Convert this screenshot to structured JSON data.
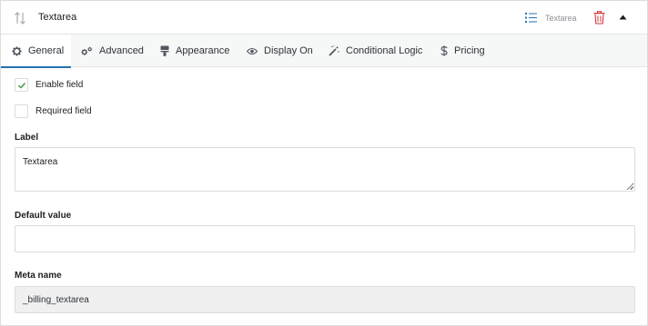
{
  "header": {
    "title": "Textarea",
    "type_label": "Textarea",
    "icons": {
      "sort": "sort-arrows-icon",
      "type": "list-icon",
      "delete": "trash-icon",
      "collapse": "caret-up-icon"
    }
  },
  "tabs": [
    {
      "label": "General",
      "icon": "gear-icon",
      "active": true
    },
    {
      "label": "Advanced",
      "icon": "gears-icon",
      "active": false
    },
    {
      "label": "Appearance",
      "icon": "paint-roller-icon",
      "active": false
    },
    {
      "label": "Display On",
      "icon": "eye-icon",
      "active": false
    },
    {
      "label": "Conditional Logic",
      "icon": "magic-wand-icon",
      "active": false
    },
    {
      "label": "Pricing",
      "icon": "dollar-icon",
      "active": false
    }
  ],
  "general": {
    "enable_field": {
      "label": "Enable field",
      "checked": true
    },
    "required_field": {
      "label": "Required field",
      "checked": false
    },
    "label": {
      "label": "Label",
      "value": "Textarea"
    },
    "default_value": {
      "label": "Default value",
      "value": ""
    },
    "meta_name": {
      "label": "Meta name",
      "value": "_billing_textarea"
    }
  },
  "colors": {
    "accent": "#2271b1",
    "check": "#3d9a3d",
    "delete": "#d63638",
    "list_icon": "#2271b1",
    "border": "#dcdcde",
    "tab_bg": "#f6f7f7"
  }
}
